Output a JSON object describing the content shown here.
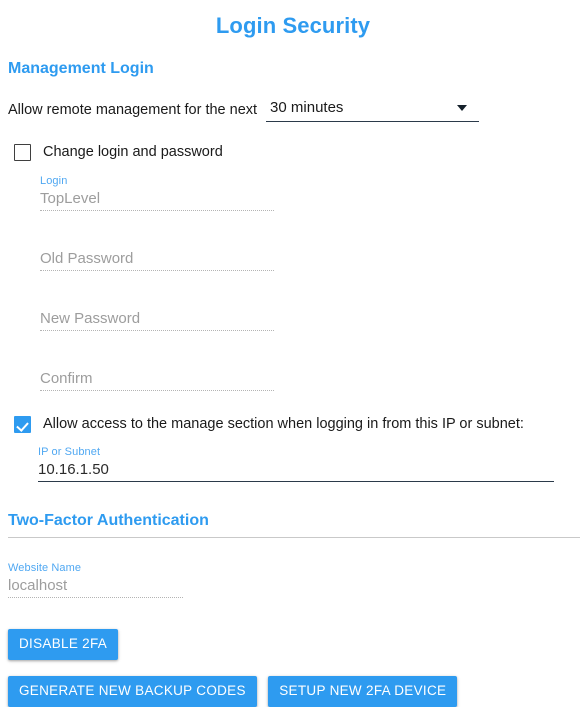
{
  "page": {
    "title": "Login Security",
    "accent_color": "#2e9bf0"
  },
  "management_login": {
    "heading": "Management Login",
    "remote": {
      "label": "Allow remote management for the next",
      "selected": "30 minutes",
      "arrow_icon": "chevron-down-icon"
    },
    "change_credentials": {
      "label": "Change login and password",
      "checked": false
    },
    "fields": [
      {
        "label": "Login",
        "value": "TopLevel",
        "disabled": true
      },
      {
        "label": "",
        "value": "Old Password",
        "disabled": true
      },
      {
        "label": "",
        "value": "New Password",
        "disabled": true
      },
      {
        "label": "",
        "value": "Confirm",
        "disabled": true
      }
    ],
    "ip_access": {
      "label": "Allow access to the manage section when logging in from this IP or subnet:",
      "checked": true,
      "field_label": "IP or Subnet",
      "field_value": "10.16.1.50"
    }
  },
  "two_factor": {
    "heading": "Two-Factor Authentication",
    "website_name": {
      "label": "Website Name",
      "value": "localhost"
    },
    "buttons": {
      "disable": "DISABLE 2FA",
      "generate_codes": "GENERATE NEW BACKUP CODES",
      "setup_device": "SETUP NEW 2FA DEVICE"
    }
  }
}
